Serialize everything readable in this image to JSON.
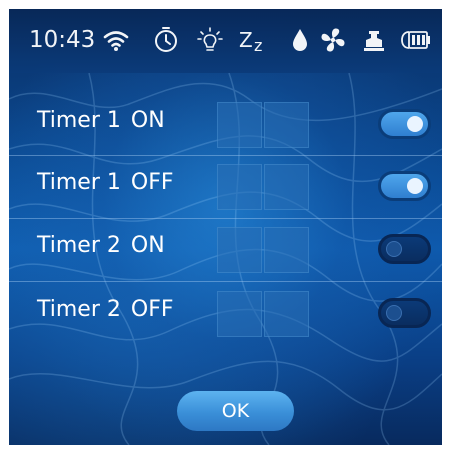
{
  "status_bar": {
    "time": "10:43",
    "icons": [
      "wifi-icon",
      "clock-timer-icon",
      "light-bulb-icon",
      "sleep-icon",
      "water-drop-icon",
      "fan-icon",
      "heater-icon",
      "battery-icon"
    ]
  },
  "timers": [
    {
      "name": "Timer 1",
      "state": "ON",
      "toggle_on": true
    },
    {
      "name": "Timer 1",
      "state": "OFF",
      "toggle_on": true
    },
    {
      "name": "Timer 2",
      "state": "ON",
      "toggle_on": false
    },
    {
      "name": "Timer 2",
      "state": "OFF",
      "toggle_on": false
    }
  ],
  "ok_label": "OK",
  "colors": {
    "background": "#0b4a93",
    "toggle_on": "#3d92de",
    "toggle_off": "#0a2d60",
    "button": "#4aa2e6"
  }
}
